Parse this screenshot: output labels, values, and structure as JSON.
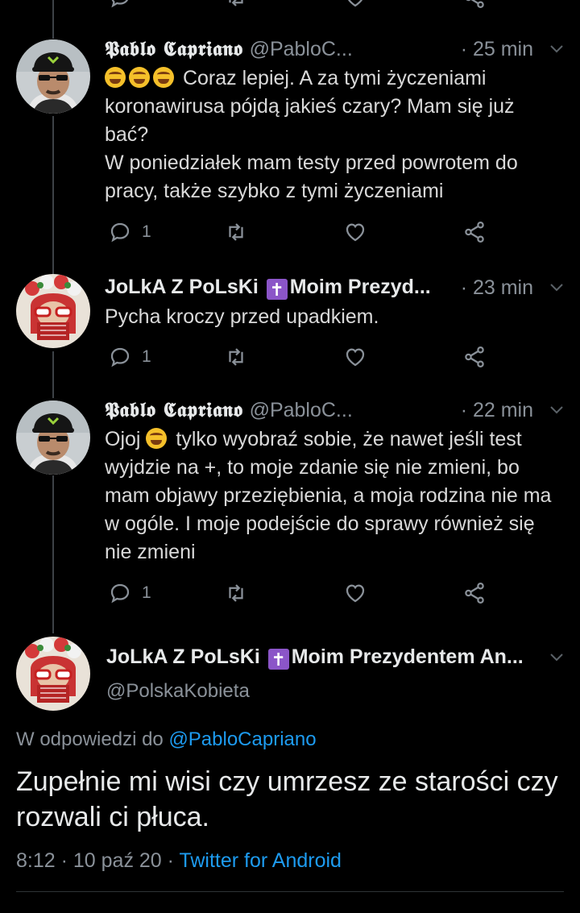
{
  "tweets": [
    {
      "name": "𝕻𝖆𝖇𝖑𝖔 𝕮𝖆𝖕𝖗𝖎𝖆𝖓𝖔",
      "handle": "@PabloC...",
      "time": "· 25 min",
      "emoji_count": 3,
      "text": "Coraz lepiej. A za tymi życzeniami koronawirusa pójdą jakieś czary? Mam się już bać?\nW poniedziałek mam testy przed powrotem do pracy, także szybko z tymi życzeniami",
      "reply_count": "1"
    },
    {
      "name_prefix": "JoLkA Z PoLsKi",
      "name_suffix": "Moim Prezyd...",
      "time": "· 23 min",
      "text": "Pycha kroczy przed upadkiem.",
      "reply_count": "1"
    },
    {
      "name": "𝕻𝖆𝖇𝖑𝖔 𝕮𝖆𝖕𝖗𝖎𝖆𝖓𝖔",
      "handle": "@PabloC...",
      "time": "· 22 min",
      "text_before_emoji": "Ojoj",
      "text": "tylko wyobraź sobie, że nawet jeśli test wyjdzie na +, to moje zdanie się nie zmieni, bo mam objawy przeziębienia, a moja rodzina nie ma w ogóle. I moje podejście do sprawy również się nie zmieni",
      "reply_count": "1"
    }
  ],
  "main_tweet": {
    "name_prefix": "JoLkA Z PoLsKi",
    "name_suffix": "Moim Prezydentem An...",
    "handle": "@PolskaKobieta",
    "reply_label": "W odpowiedzi do",
    "reply_mention": "@PabloCapriano",
    "text": "Zupełnie mi wisi czy umrzesz ze starości czy rozwali ci płuca.",
    "time": "8:12",
    "date": "10 paź 20",
    "client": "Twitter for Android"
  },
  "icons": [
    "reply-icon",
    "retweet-icon",
    "like-icon",
    "share-icon",
    "chevron-down-icon",
    "latin-cross-icon"
  ],
  "colors": {
    "background": "#000000",
    "muted": "#8a9199",
    "link": "#1d9bf0",
    "cross_badge": "#8b55c8"
  }
}
